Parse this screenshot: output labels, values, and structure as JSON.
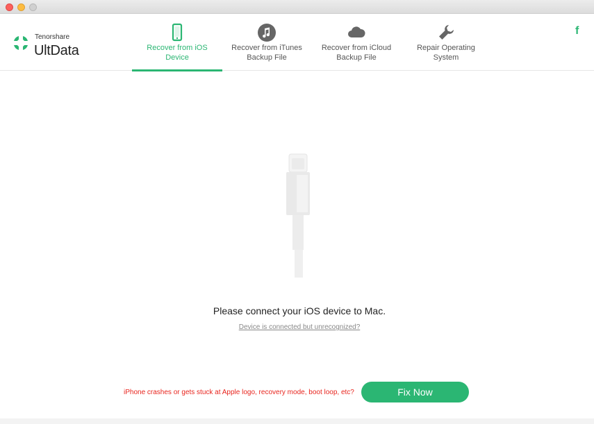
{
  "app": {
    "brand": "Tenorshare",
    "product": "UltData"
  },
  "tabs": [
    {
      "label": "Recover from iOS\nDevice",
      "icon": "phone-icon",
      "active": true
    },
    {
      "label": "Recover from iTunes\nBackup File",
      "icon": "music-note-icon",
      "active": false
    },
    {
      "label": "Recover from iCloud\nBackup File",
      "icon": "cloud-icon",
      "active": false
    },
    {
      "label": "Repair Operating\nSystem",
      "icon": "wrench-icon",
      "active": false
    }
  ],
  "header": {
    "facebook": "f"
  },
  "main": {
    "prompt": "Please connect your iOS device to Mac.",
    "help_link": "Device is connected but unrecognized?",
    "bottom_note": "iPhone crashes or gets stuck at Apple logo, recovery mode, boot loop, etc?",
    "fix_button": "Fix Now"
  },
  "colors": {
    "accent": "#2bb673",
    "warning": "#e8251e"
  }
}
